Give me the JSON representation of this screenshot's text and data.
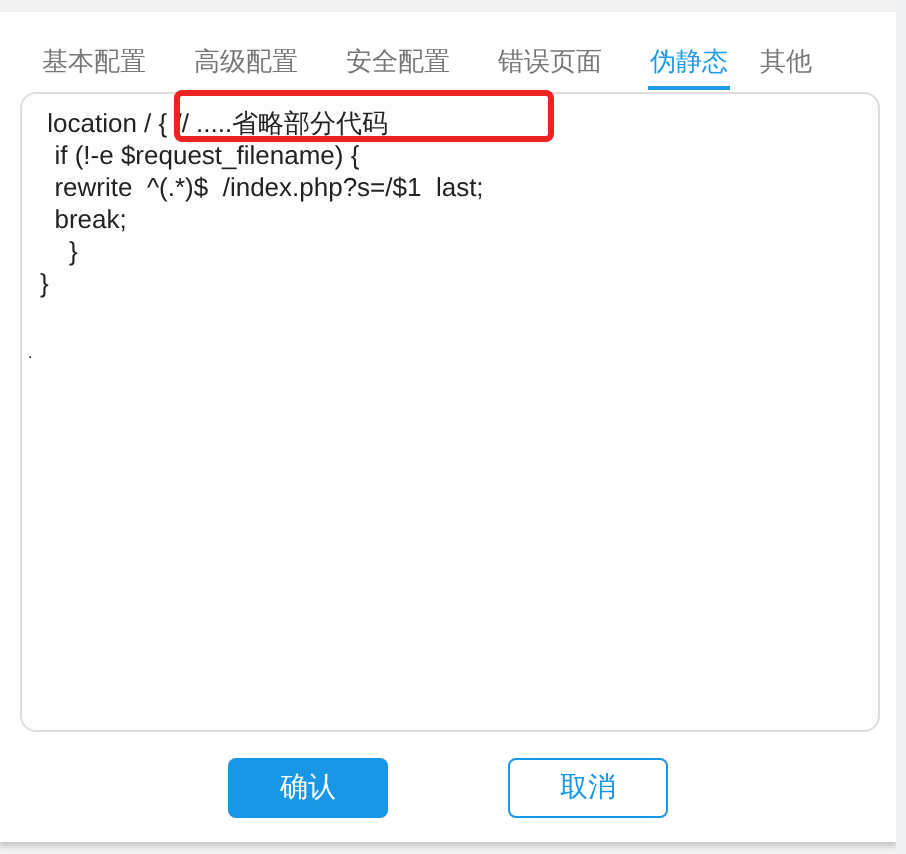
{
  "tabs": [
    {
      "label": "基本配置",
      "selected": false
    },
    {
      "label": "高级配置",
      "selected": false
    },
    {
      "label": "安全配置",
      "selected": false
    },
    {
      "label": "错误页面",
      "selected": false
    },
    {
      "label": "伪静态",
      "selected": true
    },
    {
      "label": "其他",
      "selected": false
    }
  ],
  "editor": {
    "lines": [
      " location / { // .....省略部分代码",
      "  if (!-e $request_filename) {",
      "  rewrite  ^(.*)$  /index.php?s=/$1  last;",
      "  break;",
      "    }",
      "}"
    ],
    "stray_mark": "."
  },
  "buttons": [
    {
      "label": "确认",
      "kind": "primary"
    },
    {
      "label": "取消",
      "kind": "secondary"
    }
  ]
}
